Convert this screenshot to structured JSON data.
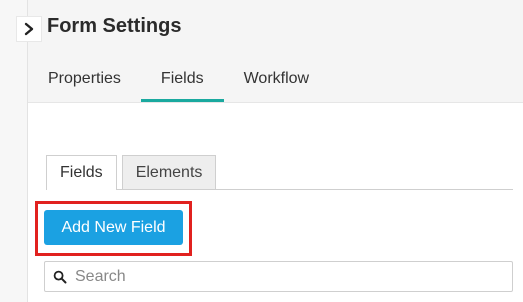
{
  "panel": {
    "title": "Form Settings"
  },
  "main_tabs": [
    {
      "label": "Properties"
    },
    {
      "label": "Fields"
    },
    {
      "label": "Workflow"
    }
  ],
  "sub_tabs": [
    {
      "label": "Fields"
    },
    {
      "label": "Elements"
    }
  ],
  "actions": {
    "add_field_label": "Add New Field"
  },
  "search": {
    "placeholder": "Search",
    "value": ""
  },
  "colors": {
    "accent": "#1aa99f",
    "button": "#1ba1e2",
    "highlight": "#e1211f"
  },
  "icons": {
    "collapse": "chevron-right-icon",
    "search": "search-icon"
  }
}
